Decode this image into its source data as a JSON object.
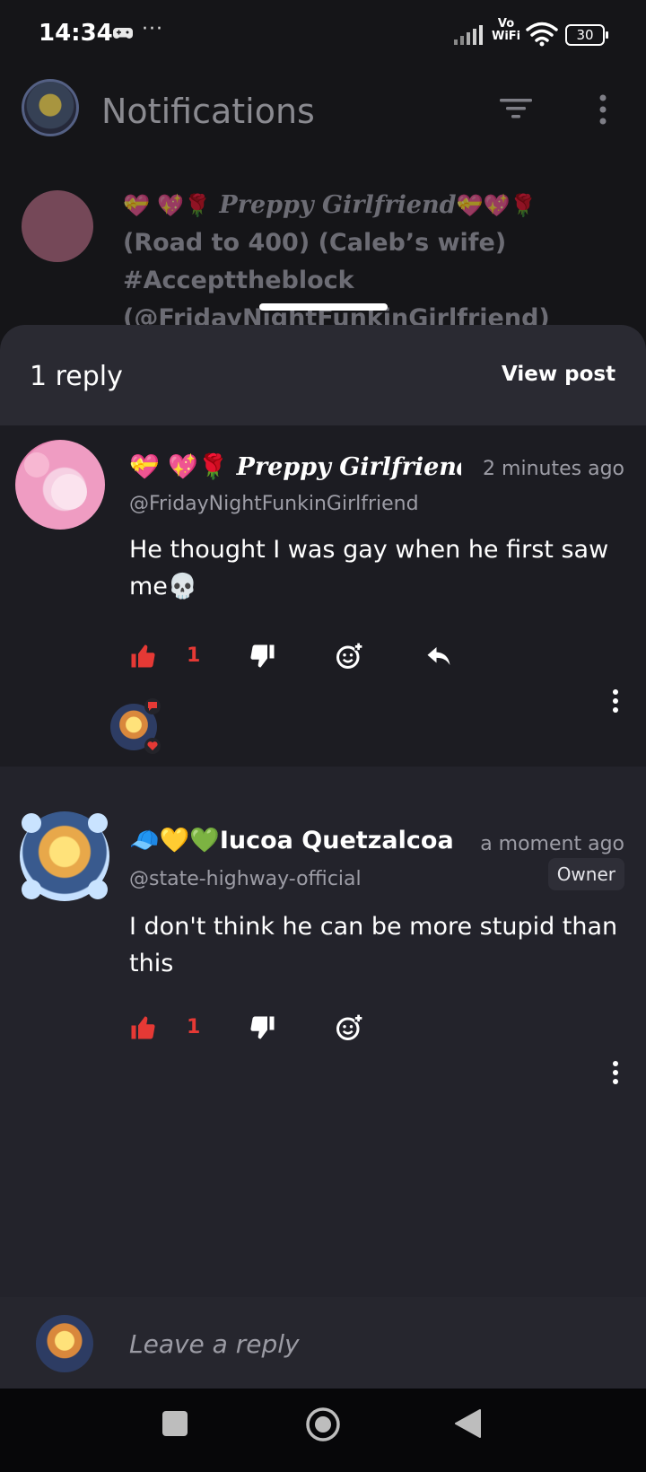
{
  "status_bar": {
    "time": "14:34",
    "dots": "···",
    "vowifi_top": "Vo",
    "vowifi_bottom": "WiFi",
    "battery": "30"
  },
  "header": {
    "title": "Notifications"
  },
  "background_notification": {
    "name_emoji_left": "💝 💖🌹",
    "name_script": "Preppy Girlfriend",
    "name_emoji_right": "💝💖🌹",
    "line2": "(Road to 400) (Caleb’s wife)",
    "line3": "#Accepttheblock",
    "line4": "(@FridayNightFunkinGirlfriend)"
  },
  "sheet": {
    "reply_count": "1 reply",
    "view_post": "View post"
  },
  "comments": [
    {
      "emoji": "💝 💖🌹 ",
      "name_script": "Preppy Girlfriend",
      "time": "2 minutes ago",
      "handle": "@FridayNightFunkinGirlfriend",
      "body": "He thought I was gay when he first saw me💀",
      "likes": "1"
    },
    {
      "emoji": "🧢💛💚",
      "name": "Iucoa Quetzalcoat",
      "time": "a moment ago",
      "handle": "@state-highway-official",
      "badge": "Owner",
      "body": "I don't think he can be more stupid than this",
      "likes": "1"
    }
  ],
  "composer": {
    "placeholder": "Leave a reply"
  },
  "colors": {
    "accent_red": "#e53935",
    "sheet_bg": "#23232b",
    "header_bg": "#2a2a32"
  }
}
